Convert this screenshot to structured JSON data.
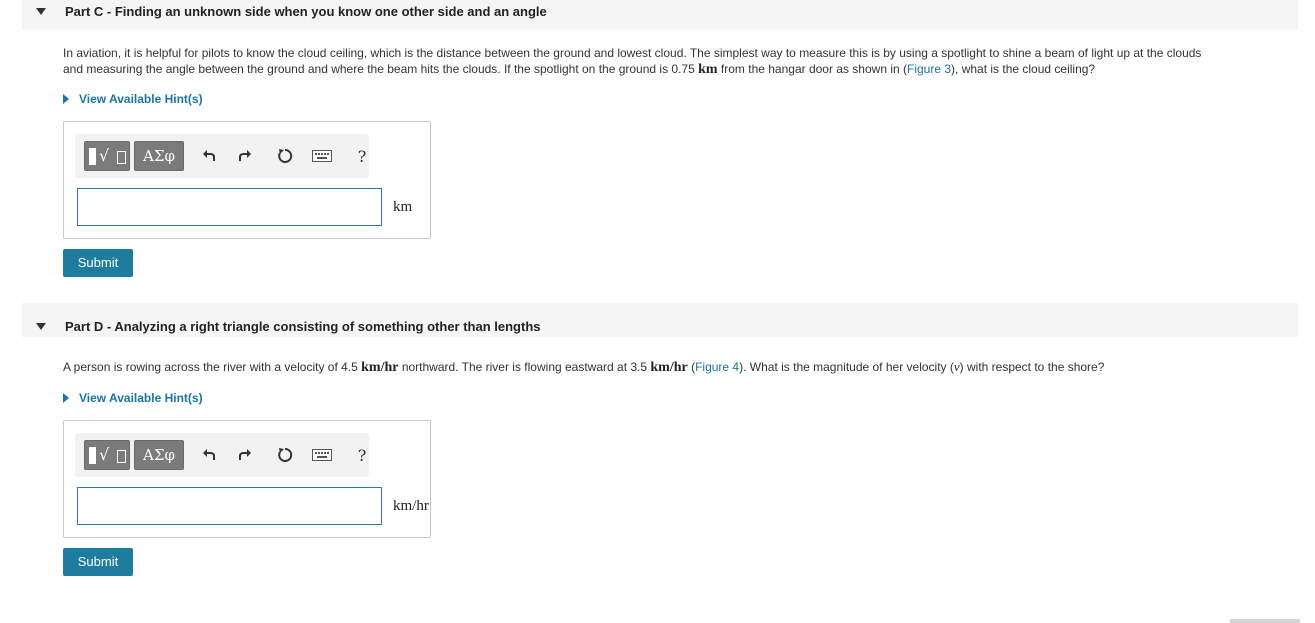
{
  "parts": [
    {
      "title": "Part C - Finding an unknown side when you know one other side and an angle",
      "question": {
        "line1": "In aviation, it is helpful for pilots to know the cloud ceiling, which is the distance between the ground and lowest cloud. The simplest way to measure this is by using a spotlight to shine a beam of light up at the clouds",
        "line2_a": "and measuring the angle between the ground and where the beam hits the clouds. If the spotlight on the ground is 0.75 ",
        "line2_unit": "km",
        "line2_b": " from the hangar door as shown in (",
        "figure_link": "Figure 3",
        "line2_c": "), what is the cloud ceiling?"
      },
      "hint_label": "View Available Hint(s)",
      "toolbar": {
        "greek_label": "ΑΣφ",
        "help_label": "?"
      },
      "input_value": "",
      "unit": "km",
      "submit_label": "Submit"
    },
    {
      "title": "Part D - Analyzing a right triangle consisting of something other than lengths",
      "question": {
        "seg1": "A person is rowing across the river with a velocity of 4.5 ",
        "unit1": "km/hr",
        "seg2": " northward. The river is flowing eastward at 3.5 ",
        "unit2": "km/hr",
        "seg3": " (",
        "figure_link": "Figure 4",
        "seg4": "). What is the magnitude of her velocity (",
        "var": "v",
        "seg5": ") with respect to the shore?"
      },
      "hint_label": "View Available Hint(s)",
      "toolbar": {
        "greek_label": "ΑΣφ",
        "help_label": "?"
      },
      "input_value": "",
      "unit": "km/hr",
      "submit_label": "Submit"
    }
  ],
  "colors": {
    "link": "#1a75a8",
    "submit": "#1e7d9f",
    "header_bg": "#f5f5f5",
    "input_border": "#2b7aa5"
  }
}
